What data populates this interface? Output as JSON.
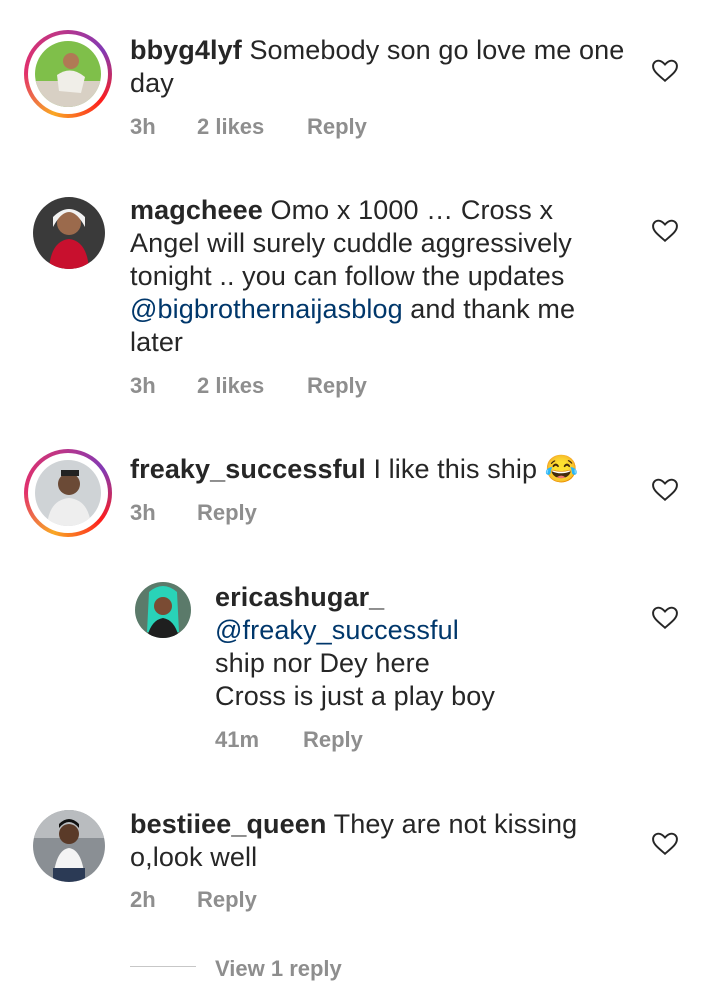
{
  "comments": [
    {
      "username": "bbyg4lyf",
      "text": "Somebody son go love me one day",
      "time": "3h",
      "likes": "2 likes",
      "reply": "Reply"
    },
    {
      "username": "magcheee",
      "text_before": "Omo x 1000 … Cross x Angel will surely cuddle aggressively tonight .. you can follow the updates ",
      "mention": "@bigbrothernaijasblog",
      "text_after": " and thank me later",
      "time": "3h",
      "likes": "2 likes",
      "reply": "Reply"
    },
    {
      "username": "freaky_successful",
      "text": "I like this ship 😂",
      "time": "3h",
      "reply": "Reply"
    },
    {
      "username": "ericashugar_",
      "mention": "@freaky_successful",
      "text": " ship nor Dey here",
      "text_line2": "Cross is just a play boy",
      "time": "41m",
      "reply": "Reply"
    },
    {
      "username": "bestiiee_queen",
      "text": "They are not kissing o,look well",
      "time": "2h",
      "reply": "Reply"
    }
  ],
  "view_replies": "View 1 reply",
  "icons": {
    "like": "heart-outline-icon"
  }
}
